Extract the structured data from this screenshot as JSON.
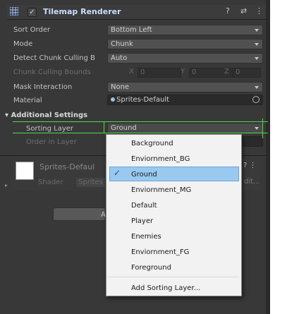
{
  "component": {
    "title": "Tilemap Renderer",
    "icon": "tilemap-grid-icon",
    "enabled_check": "✓",
    "tools": [
      "?",
      "⇄",
      "⋮"
    ]
  },
  "properties": {
    "sort_order_label": "Sort Order",
    "sort_order_value": "Bottom Left",
    "mode_label": "Mode",
    "mode_value": "Chunk",
    "detect_label": "Detect Chunk Culling B",
    "detect_value": "Auto",
    "bounds_label": "Chunk Culling Bounds",
    "bounds_x_label": "X",
    "bounds_x": "0",
    "bounds_y_label": "Y",
    "bounds_y": "0",
    "bounds_z_label": "Z",
    "bounds_z": "0",
    "mask_label": "Mask Interaction",
    "mask_value": "None",
    "material_label": "Material",
    "material_value": "Sprites-Default",
    "additional_label": "Additional Settings",
    "sorting_layer_label": "Sorting Layer",
    "sorting_layer_value": "Ground",
    "order_label": "Order in Layer"
  },
  "material_preview": {
    "name": "Sprites-Defaul",
    "shader_label": "Shader",
    "shader_value": "Sprites",
    "edit_fragment": "dit...",
    "tools": "? ⋮"
  },
  "add_button_fragment": "A",
  "dropdown": {
    "items": [
      {
        "label": "Background",
        "selected": false
      },
      {
        "label": "Enviornment_BG",
        "selected": false
      },
      {
        "label": "Ground",
        "selected": true
      },
      {
        "label": "Enviornment_MG",
        "selected": false
      },
      {
        "label": "Default",
        "selected": false
      },
      {
        "label": "Player",
        "selected": false
      },
      {
        "label": "Enemies",
        "selected": false
      },
      {
        "label": "Enviornment_FG",
        "selected": false
      },
      {
        "label": "Foreground",
        "selected": false
      }
    ],
    "add_label": "Add Sorting Layer...",
    "check_glyph": "✓"
  },
  "colors": {
    "panel_bg": "#383838",
    "field_bg": "#2a2a2a",
    "combo_bg": "#515151",
    "highlight": "#99c9ef",
    "annotation_green": "#4cdc4c",
    "title_blue": "#c9ddff"
  }
}
